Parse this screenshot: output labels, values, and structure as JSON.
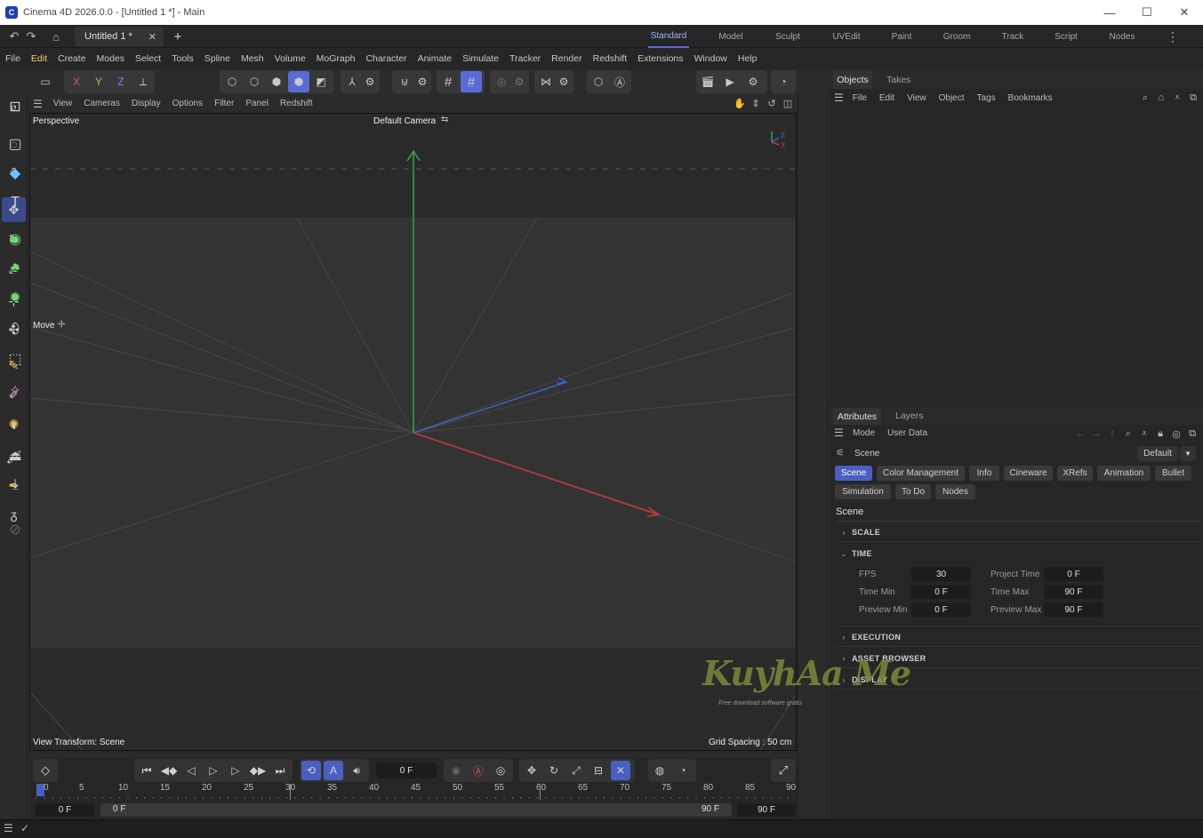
{
  "window": {
    "title": "Cinema 4D 2026.0.0 - [Untitled 1 *] - Main",
    "logo_letter": "C",
    "minimize_glyph": "—",
    "maximize_glyph": "☐",
    "close_glyph": "✕"
  },
  "doc_tab": {
    "label": "Untitled 1 *",
    "close": "✕",
    "add": "+"
  },
  "layouts": [
    "Standard",
    "Model",
    "Sculpt",
    "UVEdit",
    "Paint",
    "Groom",
    "Track",
    "Script",
    "Nodes"
  ],
  "active_layout": "Standard",
  "menu": [
    "File",
    "Edit",
    "Create",
    "Modes",
    "Select",
    "Tools",
    "Spline",
    "Mesh",
    "Volume",
    "MoGraph",
    "Character",
    "Animate",
    "Simulate",
    "Tracker",
    "Render",
    "Redshift",
    "Extensions",
    "Window",
    "Help"
  ],
  "toolbar": {
    "x": "X",
    "y": "Y",
    "z": "Z"
  },
  "viewport_menu": [
    "View",
    "Cameras",
    "Display",
    "Options",
    "Filter",
    "Panel",
    "Redshift"
  ],
  "viewport": {
    "name": "Perspective",
    "camera": "Default Camera",
    "tool_label": "Move",
    "view_transform": "View Transform: Scene",
    "grid_spacing": "Grid Spacing : 50 cm",
    "axis_y": "Y",
    "axis_z": "Z",
    "axis_x": "X"
  },
  "objects_panel": {
    "tabs": [
      "Objects",
      "Takes"
    ],
    "menu": [
      "File",
      "Edit",
      "View",
      "Object",
      "Tags",
      "Bookmarks"
    ]
  },
  "attributes_panel": {
    "tabs": [
      "Attributes",
      "Layers"
    ],
    "menu": [
      "Mode",
      "User Data"
    ],
    "object": "Scene",
    "preset": "Default",
    "subtabs_row1": [
      "Scene",
      "Color Management",
      "Info",
      "Cineware",
      "XRefs",
      "Animation",
      "Bullet"
    ],
    "subtabs_row2": [
      "Simulation",
      "To Do",
      "Nodes"
    ],
    "section_title": "Scene",
    "sections": {
      "scale": "SCALE",
      "time": "TIME",
      "execution": "EXECUTION",
      "asset_browser": "ASSET BROWSER",
      "display": "DISPLAY"
    },
    "time_fields": {
      "fps_label": "FPS",
      "fps": "30",
      "project_time_label": "Project Time",
      "project_time": "0 F",
      "time_min_label": "Time Min",
      "time_min": "0 F",
      "time_max_label": "Time Max",
      "time_max": "90 F",
      "preview_min_label": "Preview Min",
      "preview_min": "0 F",
      "preview_max_label": "Preview Max",
      "preview_max": "90 F"
    }
  },
  "timeline": {
    "current_frame": "0 F",
    "ticks": [
      "0",
      "5",
      "10",
      "15",
      "20",
      "25",
      "30",
      "35",
      "40",
      "45",
      "50",
      "55",
      "60",
      "65",
      "70",
      "75",
      "80",
      "85",
      "90"
    ],
    "range_start": "0 F",
    "preview_start": "0 F",
    "preview_end": "90 F",
    "range_end": "90 F"
  },
  "watermark": {
    "text": "KuyhAa Me",
    "tagline": "Free download software gratis"
  },
  "colors": {
    "accent": "#5a6bd6",
    "x_axis": "#c23b3b",
    "y_axis": "#2fa84f",
    "z_axis": "#3566c8"
  }
}
